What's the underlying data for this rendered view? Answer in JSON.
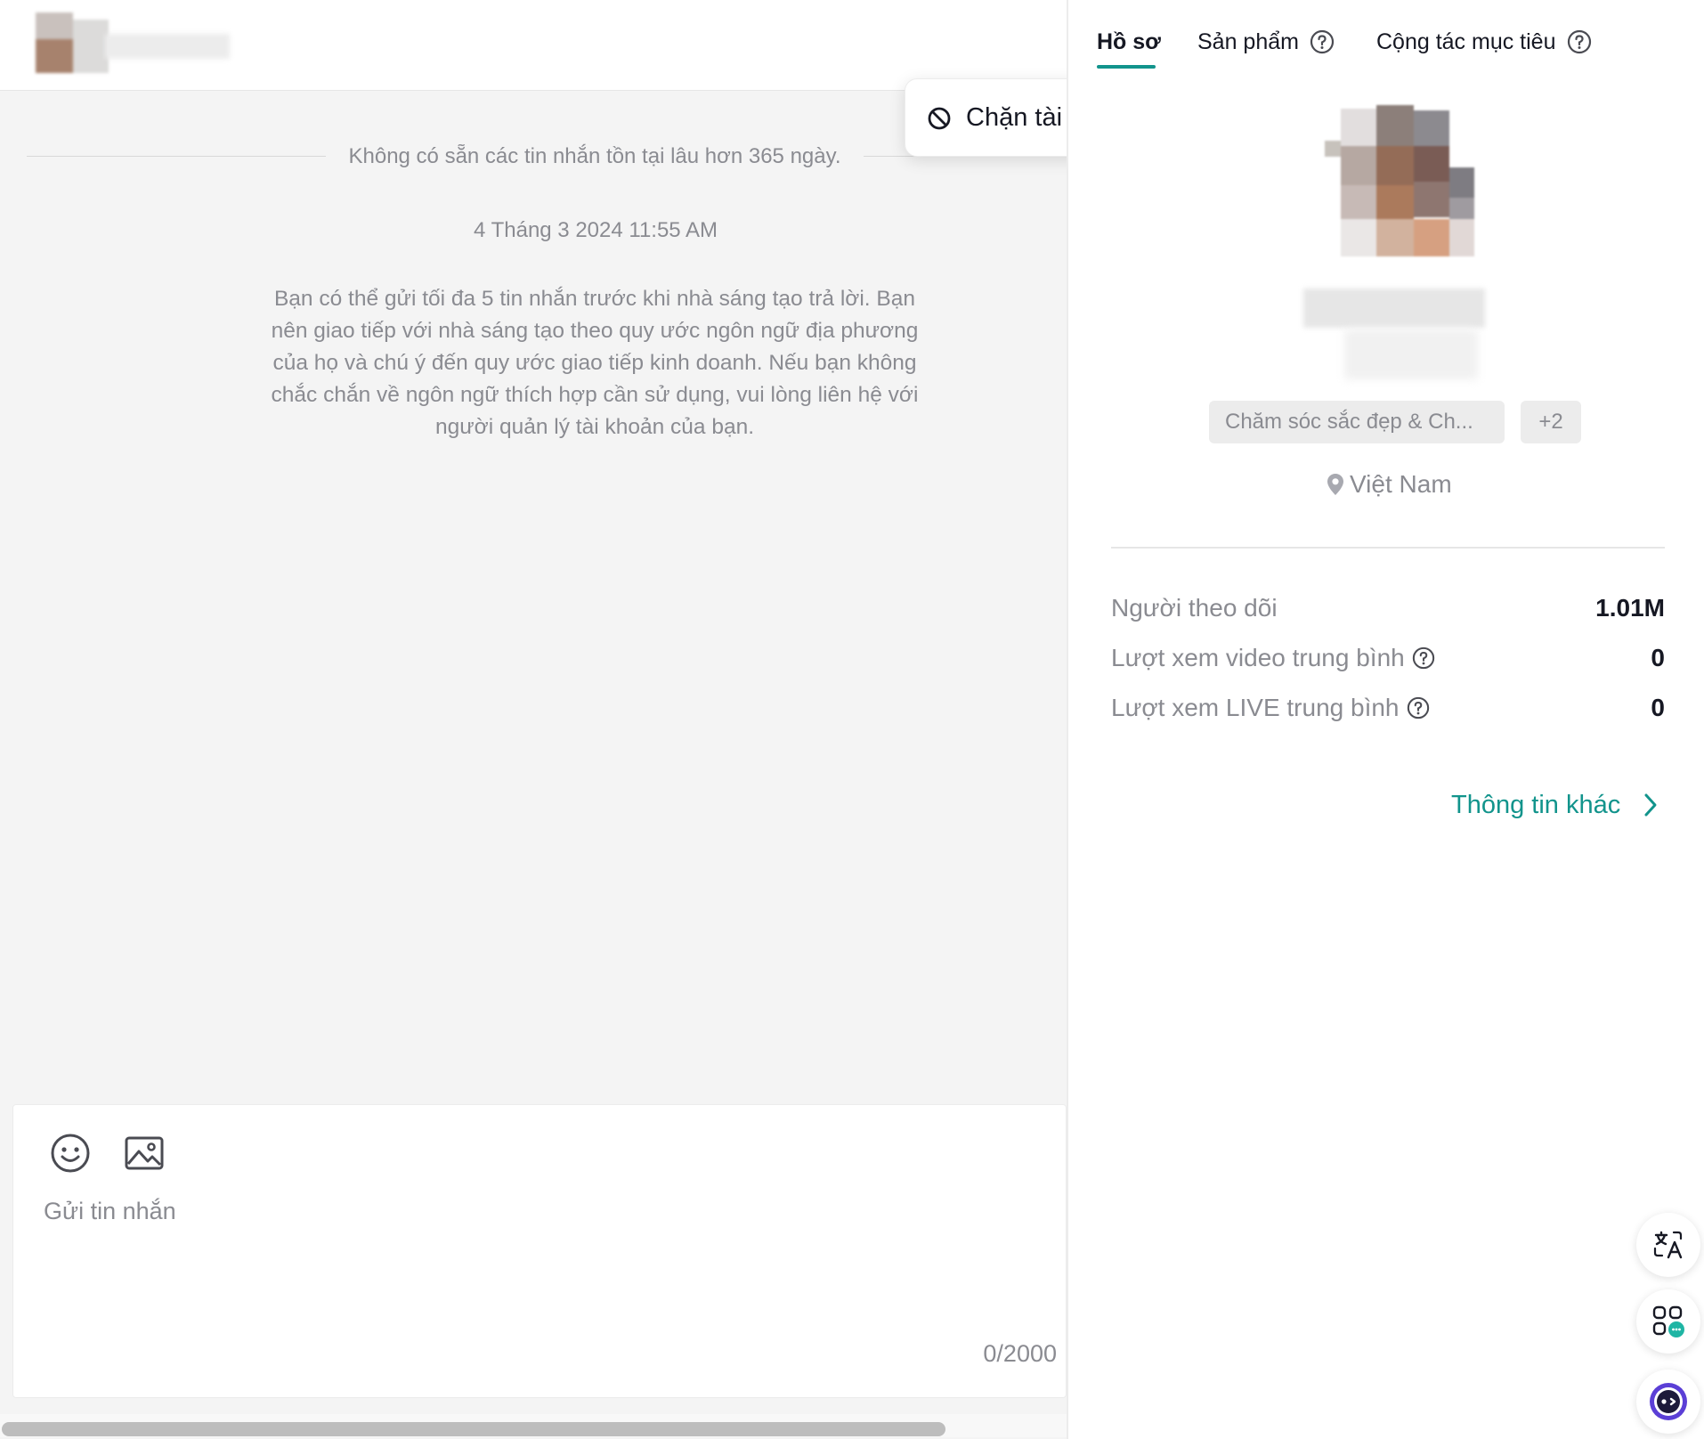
{
  "chat": {
    "retention_notice": "Không có sẵn các tin nhắn tồn tại lâu hơn 365 ngày.",
    "timestamp": "4 Tháng 3 2024 11:55 AM",
    "info_message": "Bạn có thể gửi tối đa 5 tin nhắn trước khi nhà sáng tạo trả lời. Bạn nên giao tiếp với nhà sáng tạo theo quy ước ngôn ngữ địa phương của họ và chú ý đến quy ước giao tiếp kinh doanh. Nếu bạn không chắc chắn về ngôn ngữ thích hợp cần sử dụng, vui lòng liên hệ với người quản lý tài khoản của bạn.",
    "composer": {
      "placeholder": "Gửi tin nhắn",
      "value": "",
      "char_count": "0/2000",
      "emoji_icon": "smiley-icon",
      "image_icon": "image-icon"
    }
  },
  "popup": {
    "block_label": "Chặn tài khoản",
    "icon": "ban-icon"
  },
  "profile": {
    "tabs": [
      {
        "label": "Hồ sơ",
        "active": true
      },
      {
        "label": "Sản phẩm",
        "active": false,
        "help": true
      },
      {
        "label": "Cộng tác mục tiêu",
        "active": false,
        "help": true
      }
    ],
    "category_tag": "Chăm sóc sắc đẹp & Ch...",
    "more_tags": "+2",
    "location": "Việt Nam",
    "stats": [
      {
        "label": "Người theo dõi",
        "value": "1.01M",
        "help": false
      },
      {
        "label": "Lượt xem video trung bình",
        "value": "0",
        "help": true
      },
      {
        "label": "Lượt xem LIVE trung bình",
        "value": "0",
        "help": true
      }
    ],
    "more_info": "Thông tin khác"
  },
  "fabs": {
    "translate": "translate-icon",
    "apps": "apps-chat-icon",
    "assistant": "assistant-icon"
  },
  "colors": {
    "accent": "#12948c",
    "muted_text": "#8a8b91",
    "text": "#161823",
    "chat_background": "#f4f4f4"
  }
}
